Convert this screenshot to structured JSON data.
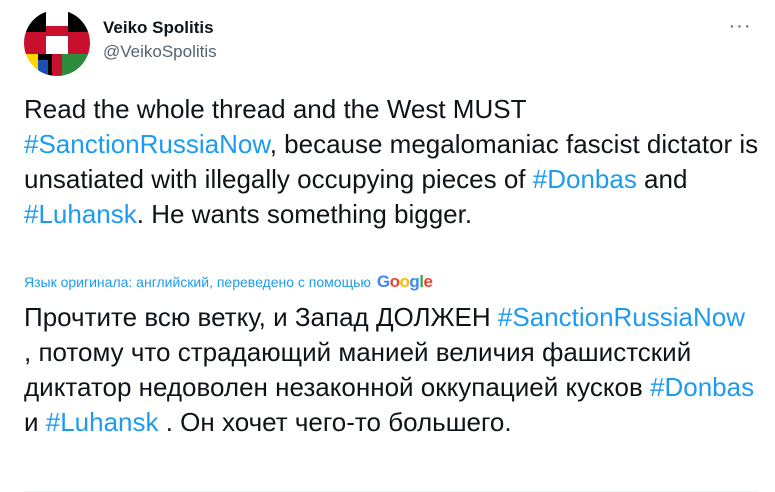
{
  "author": {
    "name": "Veiko Spolitis",
    "handle": "@VeikoSpolitis",
    "avatar_icon": "flag-mosaic-avatar"
  },
  "more_label": "···",
  "tweet_en": {
    "t1": "Read the whole thread and the West MUST ",
    "h1": "#SanctionRussiaNow",
    "t2": ", because megalomaniac fascist dictator is unsatiated with illegally occupying pieces of ",
    "h2": "#Donbas",
    "t3": " and ",
    "h3": "#Luhansk",
    "t4": ". He wants something bigger."
  },
  "translation_note": "Язык оригинала: английский, переведено с помощью",
  "translation_provider": "Google",
  "tweet_ru": {
    "t1": "Прочтите всю ветку, и Запад ДОЛЖЕН ",
    "h1": "#SanctionRussiaNow",
    "t2": " , потому что страдающий манией величия фашистский диктатор недоволен незаконной оккупацией кусков ",
    "h2": "#Donbas",
    "t3": " и ",
    "h3": "#Luhansk",
    "t4": " . Он хочет чего-то большего."
  },
  "colors": {
    "link": "#1d9bf0",
    "text": "#0f1419",
    "secondary": "#536471"
  }
}
